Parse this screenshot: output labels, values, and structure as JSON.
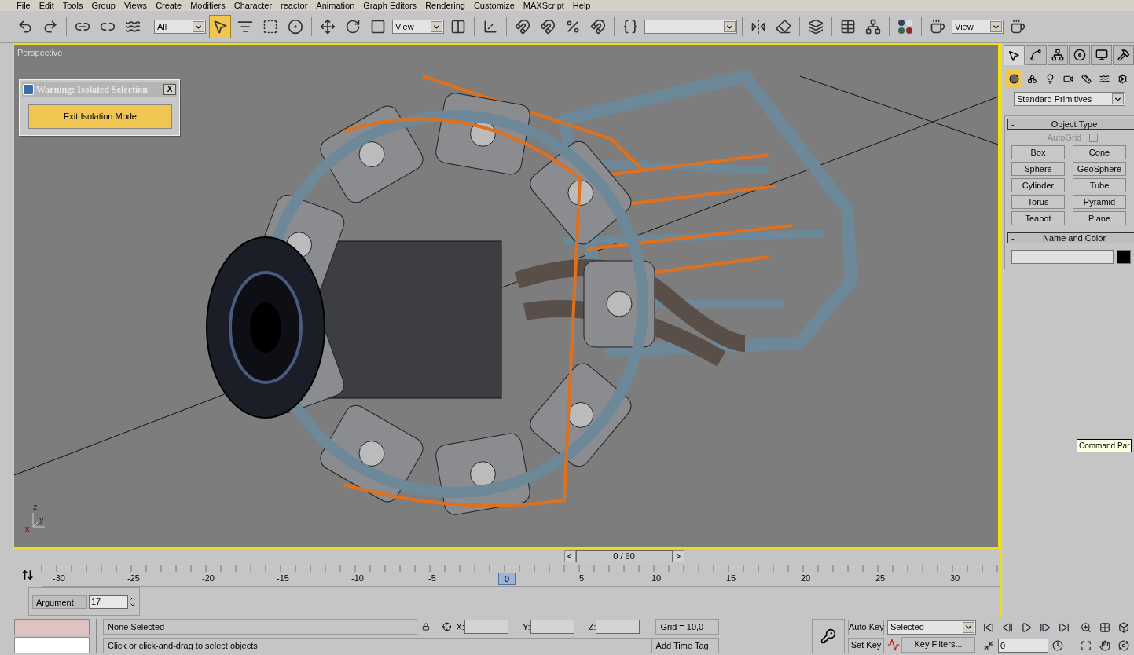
{
  "menu_bar": [
    "File",
    "Edit",
    "Tools",
    "Group",
    "Views",
    "Create",
    "Modifiers",
    "Character",
    "reactor",
    "Animation",
    "Graph Editors",
    "Rendering",
    "Customize",
    "MAXScript",
    "Help"
  ],
  "toolbar": {
    "items": [
      {
        "kind": "button",
        "selected": false
      },
      {
        "kind": "button",
        "selected": false
      },
      {
        "kind": "separator"
      },
      {
        "kind": "button",
        "selected": false
      },
      {
        "kind": "button",
        "selected": false
      },
      {
        "kind": "button",
        "selected": false
      },
      {
        "kind": "separator"
      },
      {
        "kind": "dropdown",
        "value": "All"
      },
      {
        "kind": "button",
        "selected": true
      },
      {
        "kind": "button",
        "selected": false
      },
      {
        "kind": "button",
        "selected": false
      },
      {
        "kind": "button",
        "selected": false
      },
      {
        "kind": "separator"
      },
      {
        "kind": "button",
        "selected": false
      },
      {
        "kind": "button",
        "selected": false
      },
      {
        "kind": "button",
        "selected": false
      },
      {
        "kind": "dropdown",
        "value": "View"
      },
      {
        "kind": "button",
        "selected": false
      },
      {
        "kind": "separator"
      },
      {
        "kind": "button",
        "selected": false
      },
      {
        "kind": "separator"
      },
      {
        "kind": "button",
        "selected": false
      },
      {
        "kind": "button",
        "selected": false
      },
      {
        "kind": "button",
        "selected": false
      },
      {
        "kind": "button",
        "selected": false
      },
      {
        "kind": "separator"
      },
      {
        "kind": "button",
        "selected": false
      },
      {
        "kind": "dropdown"
      },
      {
        "kind": "separator"
      },
      {
        "kind": "button",
        "selected": false
      },
      {
        "kind": "button",
        "selected": false
      },
      {
        "kind": "separator"
      },
      {
        "kind": "button",
        "selected": false
      },
      {
        "kind": "separator"
      },
      {
        "kind": "button",
        "selected": false
      },
      {
        "kind": "button",
        "selected": false
      },
      {
        "kind": "separator"
      },
      {
        "kind": "button",
        "selected": false
      },
      {
        "kind": "separator"
      },
      {
        "kind": "button",
        "selected": false
      },
      {
        "kind": "dropdown",
        "value": "View"
      },
      {
        "kind": "button",
        "selected": false
      }
    ]
  },
  "viewport": {
    "label": "Perspective",
    "active": true,
    "axes": [
      "z",
      "y",
      "x"
    ]
  },
  "isolation_dialog": {
    "title": "Warning: Isolated Selection",
    "close": "X",
    "button": "Exit Isolation Mode"
  },
  "command_panel": {
    "tabs": [
      {
        "selected": true
      },
      {
        "selected": false
      },
      {
        "selected": false
      },
      {
        "selected": false
      },
      {
        "selected": false
      },
      {
        "selected": false
      }
    ],
    "categories": [
      {
        "selected": true
      },
      {
        "selected": false
      },
      {
        "selected": false
      },
      {
        "selected": false
      },
      {
        "selected": false
      },
      {
        "selected": false
      },
      {
        "selected": false
      }
    ],
    "dropdown": "Standard Primitives",
    "rollouts": [
      {
        "kind": "object_type",
        "collapse": "-",
        "title": "Object Type",
        "autogrid": {
          "label": "AutoGrid",
          "checked": false,
          "disabled": true
        },
        "buttons": [
          "Box",
          "Cone",
          "Sphere",
          "GeoSphere",
          "Cylinder",
          "Tube",
          "Torus",
          "Pyramid",
          "Teapot",
          "Plane"
        ]
      },
      {
        "kind": "name_color",
        "collapse": "-",
        "title": "Name and Color",
        "color": "#000000"
      }
    ],
    "tooltip": "Command Par"
  },
  "time_slider": {
    "prev": "<",
    "position": "0 / 60",
    "next": ">"
  },
  "track_bar": {
    "labels": [
      {
        "text": "-30",
        "selected": false
      },
      {
        "text": "-25",
        "selected": false
      },
      {
        "text": "-20",
        "selected": false
      },
      {
        "text": "-15",
        "selected": false
      },
      {
        "text": "-10",
        "selected": false
      },
      {
        "text": "-5",
        "selected": false
      },
      {
        "text": "0",
        "selected": true
      },
      {
        "text": "5",
        "selected": false
      },
      {
        "text": "10",
        "selected": false
      },
      {
        "text": "15",
        "selected": false
      },
      {
        "text": "20",
        "selected": false
      },
      {
        "text": "25",
        "selected": false
      },
      {
        "text": "30",
        "selected": false
      }
    ]
  },
  "argument": {
    "label": "Argument",
    "value": "17"
  },
  "status": {
    "selection": "None Selected",
    "prompt": "Click or click-and-drag to select objects",
    "coords": [
      "X:",
      "Y:",
      "Z:"
    ],
    "grid": "Grid = 10,0",
    "time_tag": "Add Time Tag"
  },
  "animation": {
    "auto_key": "Auto Key",
    "key_mode": "Selected",
    "set_key": "Set Key",
    "key_filters": "Key Filters...",
    "frame": "0"
  }
}
